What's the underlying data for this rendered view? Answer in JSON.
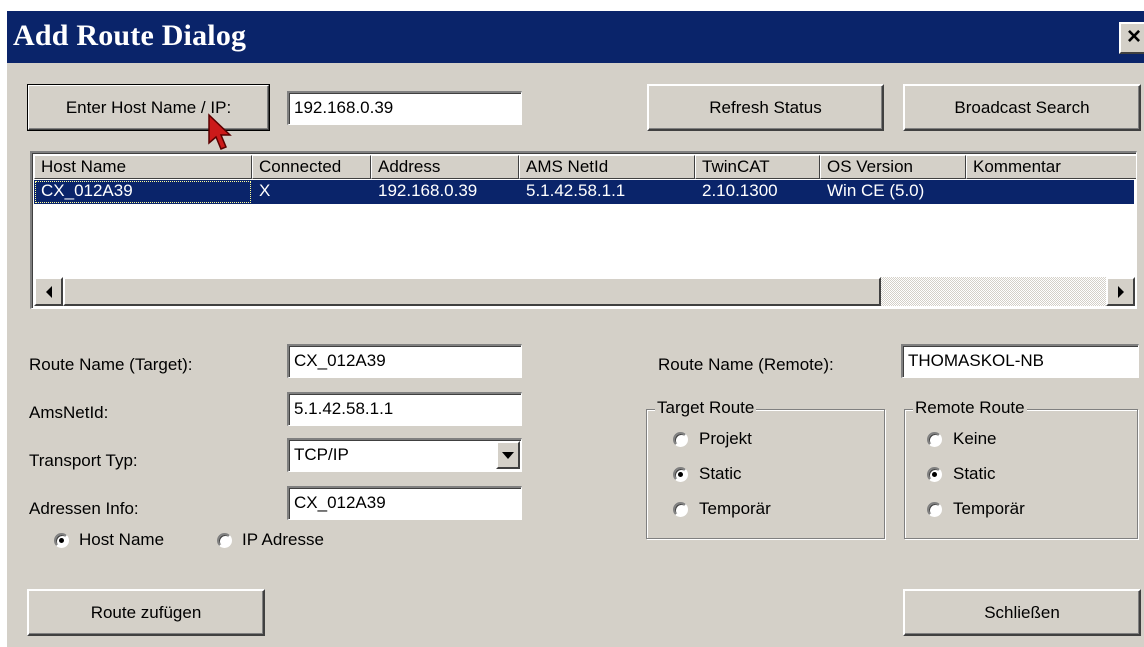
{
  "window": {
    "title": "Add Route Dialog",
    "close_glyph": "×"
  },
  "toolbar": {
    "enter_host_label": "Enter Host Name / IP:",
    "host_value": "192.168.0.39",
    "refresh_label": "Refresh Status",
    "broadcast_label": "Broadcast Search"
  },
  "table": {
    "columns": [
      "Host Name",
      "Connected",
      "Address",
      "AMS NetId",
      "TwinCAT",
      "OS Version",
      "Kommentar"
    ],
    "rows": [
      {
        "host_name": "CX_012A39",
        "connected": "X",
        "address": "192.168.0.39",
        "ams_netid": "5.1.42.58.1.1",
        "twincat": "2.10.1300",
        "os_version": "Win CE (5.0)",
        "kommentar": "",
        "selected": true
      }
    ]
  },
  "form": {
    "route_name_target_label": "Route Name (Target):",
    "route_name_target_value": "CX_012A39",
    "amsnetid_label": "AmsNetId:",
    "amsnetid_value": "5.1.42.58.1.1",
    "transport_label": "Transport Typ:",
    "transport_value": "TCP/IP",
    "adressen_label": "Adressen Info:",
    "adressen_value": "CX_012A39",
    "host_name_radio": "Host Name",
    "ip_adresse_radio": "IP Adresse",
    "route_name_remote_label": "Route Name (Remote):",
    "route_name_remote_value": "THOMASKOL-NB"
  },
  "target_route": {
    "title": "Target Route",
    "options": [
      "Projekt",
      "Static",
      "Temporär"
    ],
    "selected": "Static"
  },
  "remote_route": {
    "title": "Remote Route",
    "options": [
      "Keine",
      "Static",
      "Temporär"
    ],
    "selected": "Static"
  },
  "footer": {
    "add_route_label": "Route zufügen",
    "close_label": "Schließen"
  },
  "icons": {
    "close": "close-icon",
    "scroll_left": "scroll-left-arrow-icon",
    "scroll_right": "scroll-right-arrow-icon",
    "dropdown": "chevron-down-icon",
    "cursor": "mouse-pointer-icon"
  },
  "colors": {
    "titlebar": "#0a246a",
    "dialog_bg": "#d4d0c8",
    "selection": "#0a246a",
    "cursor": "#cc1a1a"
  }
}
